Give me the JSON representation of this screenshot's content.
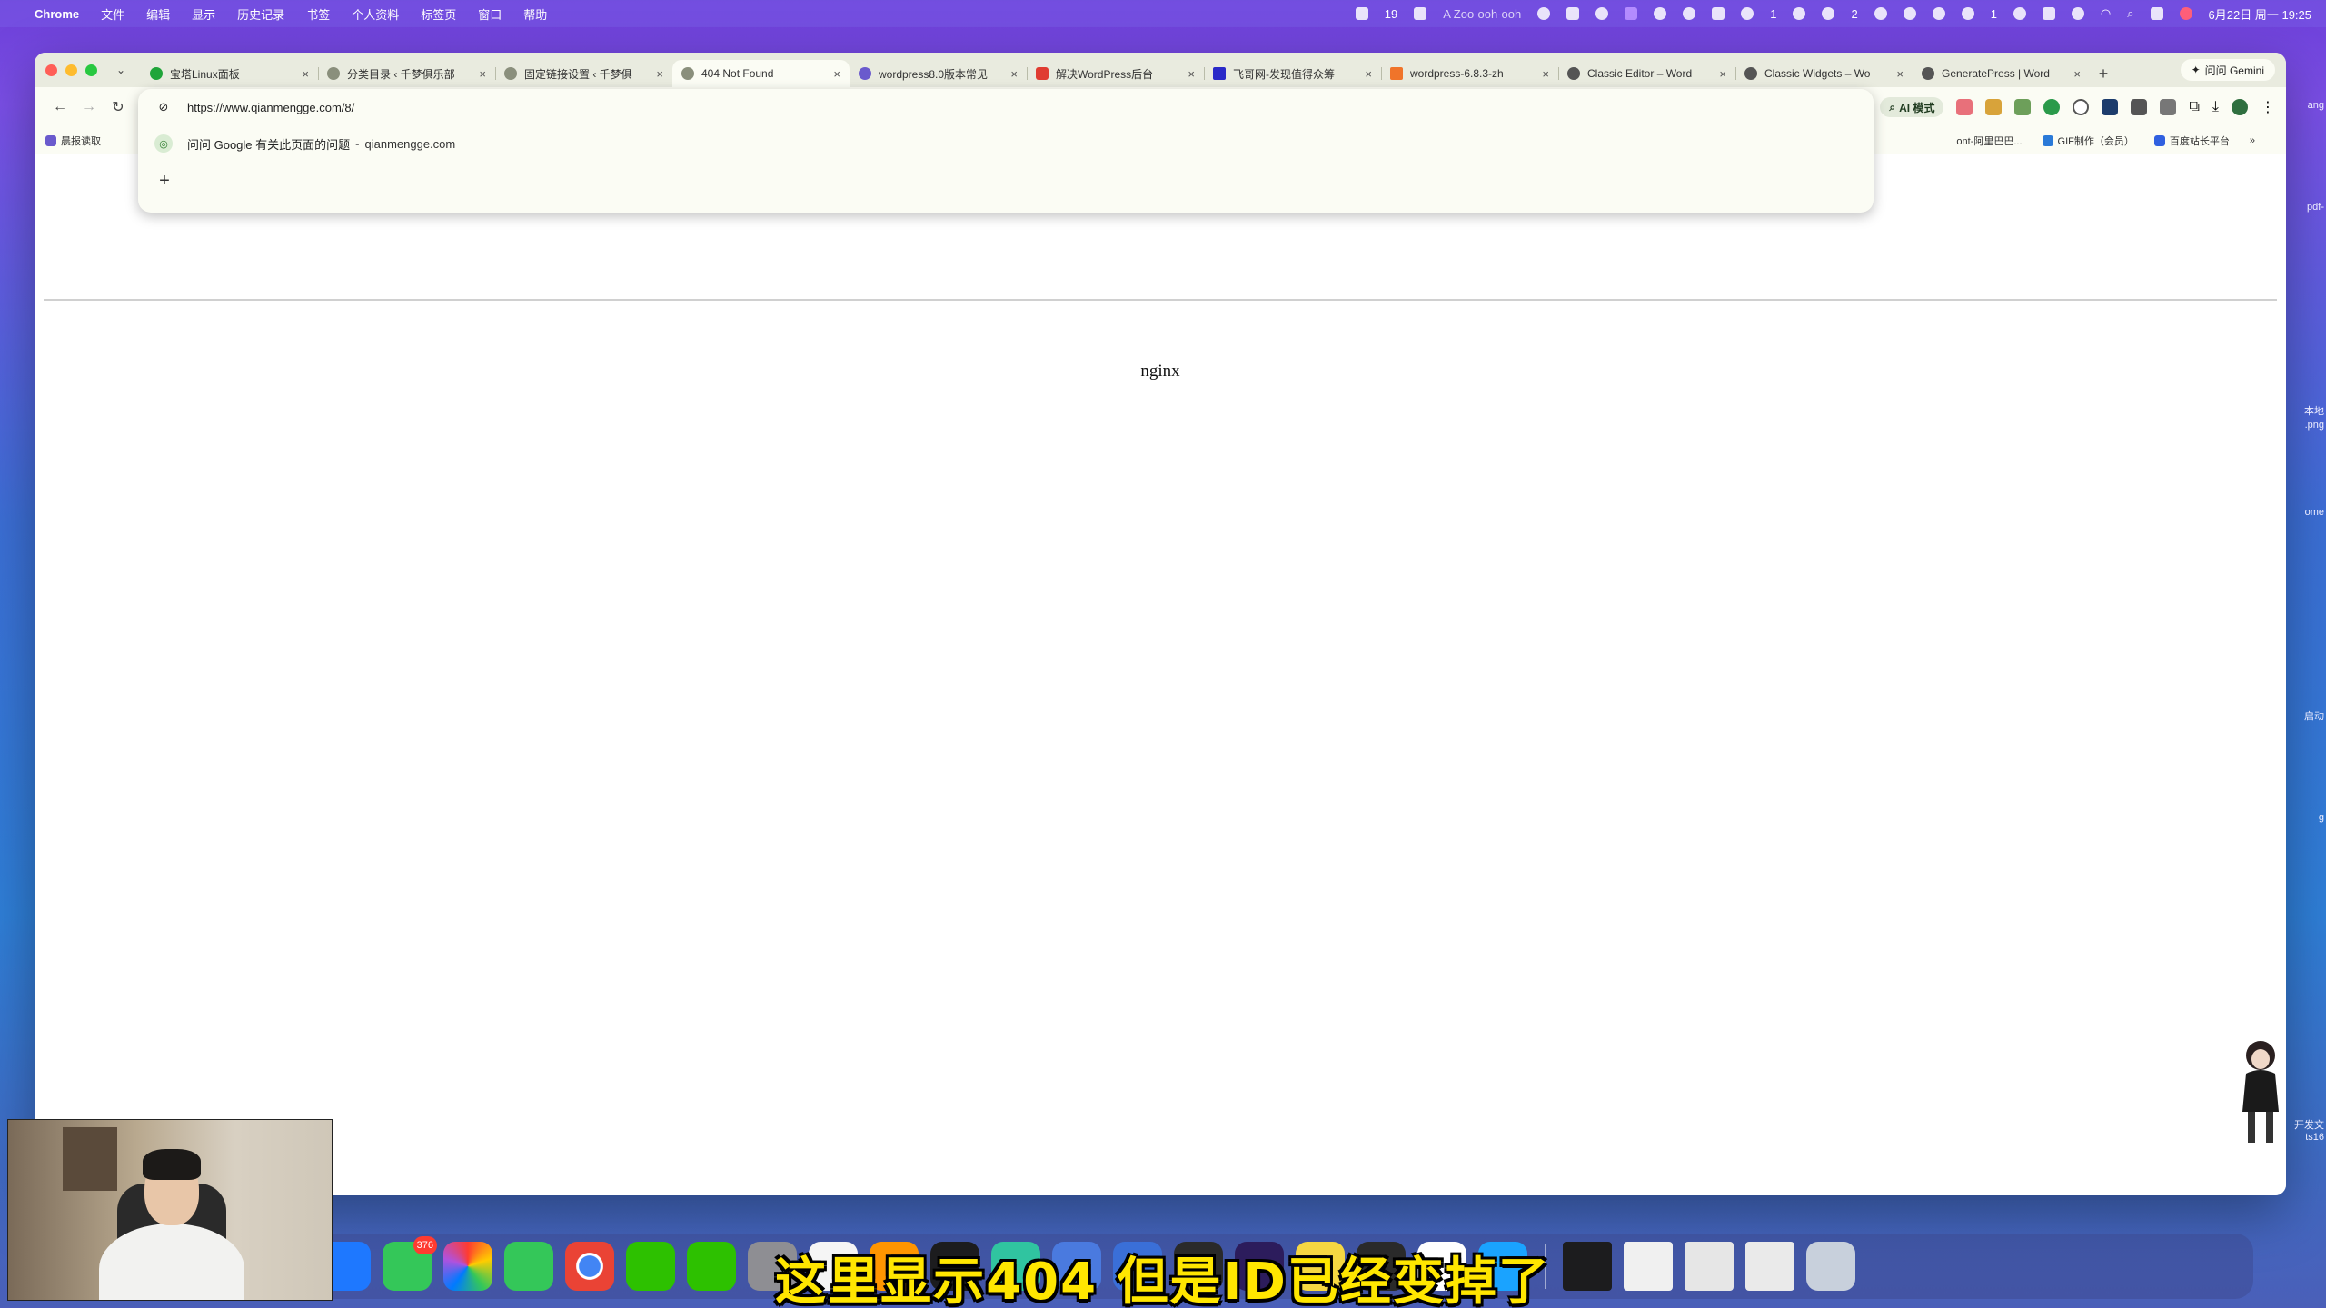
{
  "menubar": {
    "app_name": "Chrome",
    "menus": [
      "文件",
      "编辑",
      "显示",
      "历史记录",
      "书签",
      "个人资料",
      "标签页",
      "窗口",
      "帮助"
    ],
    "tray_text_1": "19",
    "now_playing": "A Zoo-ooh-ooh",
    "tray_text_2": "2",
    "tray_text_3": "1",
    "tray_text_4": "1",
    "datetime": "6月22日 周一 19:25"
  },
  "tabs": [
    {
      "title": "宝塔Linux面板",
      "active": false
    },
    {
      "title": "分类目录 ‹ 千梦俱乐部",
      "active": false
    },
    {
      "title": "固定链接设置 ‹ 千梦俱",
      "active": false
    },
    {
      "title": "404 Not Found",
      "active": true
    },
    {
      "title": "wordpress8.0版本常见",
      "active": false
    },
    {
      "title": "解决WordPress后台",
      "active": false
    },
    {
      "title": "飞哥网-发现值得众筹",
      "active": false
    },
    {
      "title": "wordpress-6.8.3-zh",
      "active": false
    },
    {
      "title": "Classic Editor – Word",
      "active": false
    },
    {
      "title": "Classic Widgets – Wo",
      "active": false
    },
    {
      "title": "GeneratePress | Word",
      "active": false
    }
  ],
  "gemini_label": "问问 Gemini",
  "toolbar": {
    "ai_mode_label": "AI 模式"
  },
  "omnibox": {
    "input_value": "https://www.qianmengge.com/8/",
    "suggestion_text": "问问 Google 有关此页面的问题",
    "suggestion_separator": "-",
    "suggestion_domain": "qianmengge.com"
  },
  "bookmarks": {
    "left": [
      "晨报读取"
    ],
    "right": [
      "ont-阿里巴巴...",
      "GIF制作（会员）",
      "百度站长平台"
    ]
  },
  "page": {
    "server_name": "nginx"
  },
  "desktop_labels": [
    "ang",
    "pdf-",
    "本地",
    ".png",
    "ome",
    "启动",
    "g",
    "开发文",
    "ts16"
  ],
  "dock": {
    "messages_badge": "376"
  },
  "subtitle": "这里显示404 但是ID已经变掉了",
  "colors": {
    "chrome_frame": "#e9ebdf",
    "toolbar_bg": "#fbfcf4",
    "subtitle_fill": "#ffe600",
    "close_red": "#ff5f57",
    "minimize_yellow": "#febc2e",
    "zoom_green": "#28c840"
  }
}
